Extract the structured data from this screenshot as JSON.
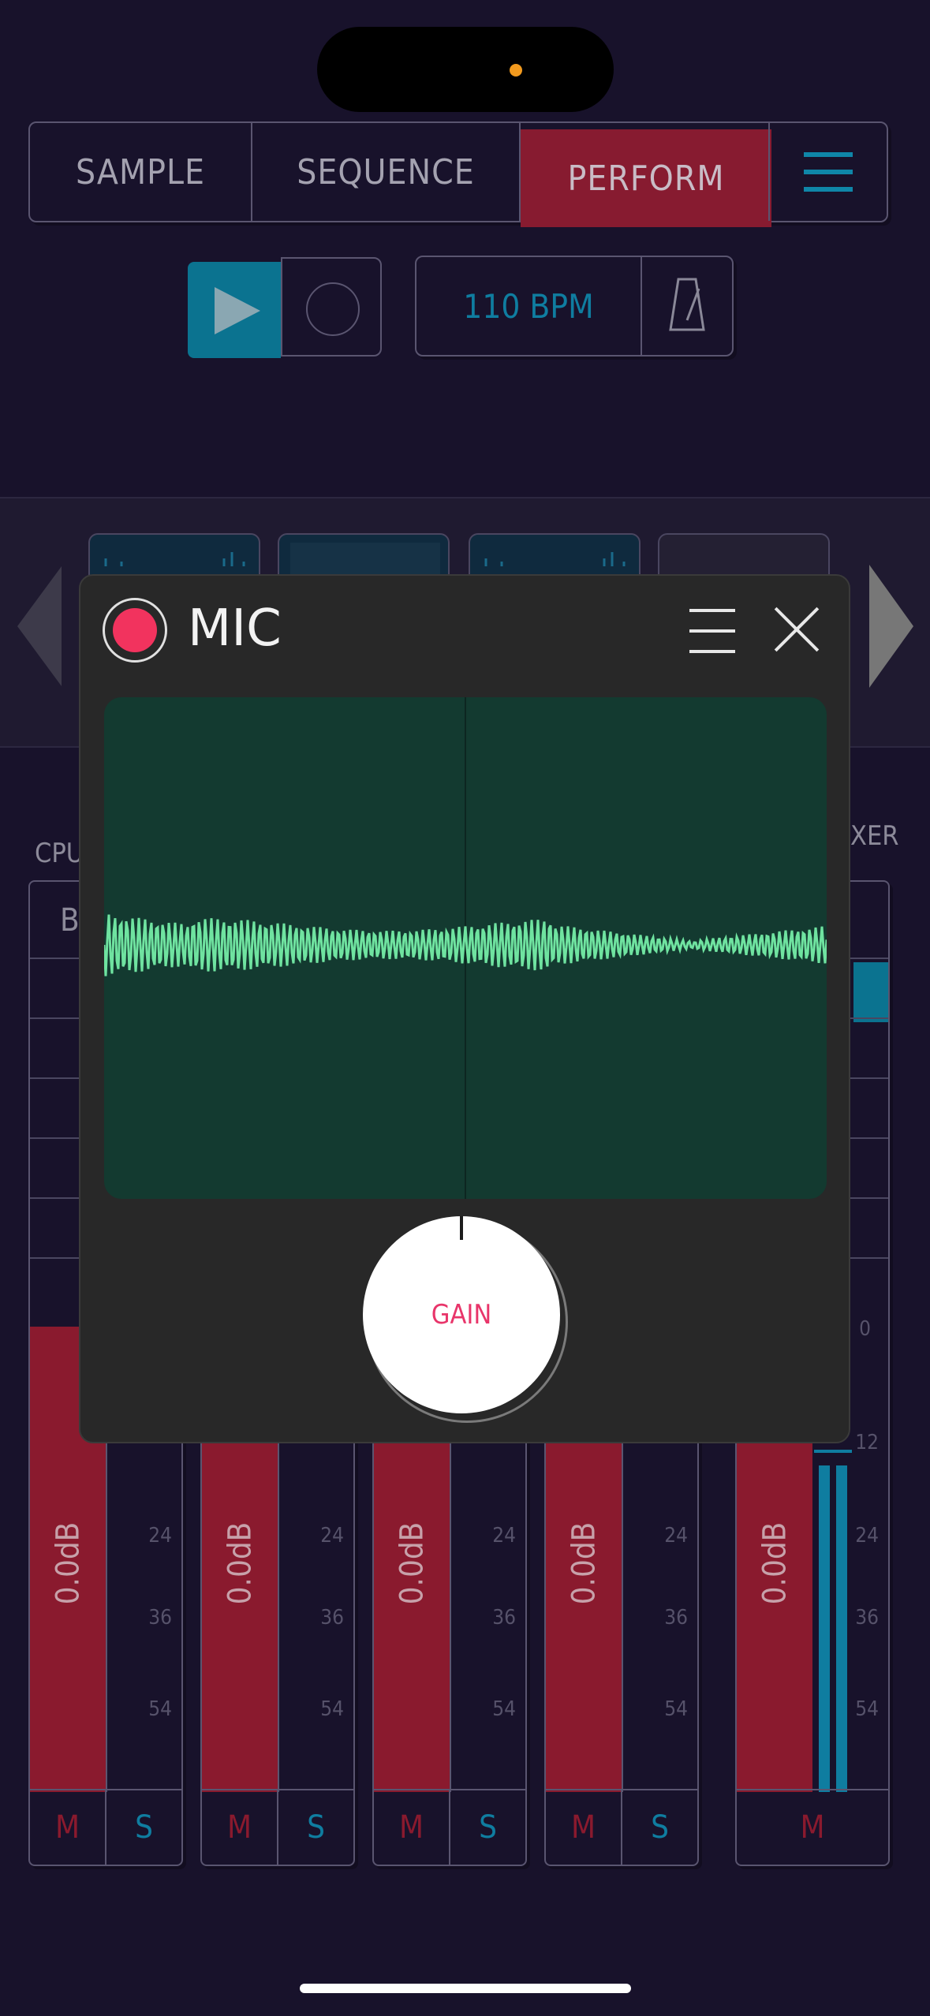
{
  "tabs": [
    {
      "label": "SAMPLE"
    },
    {
      "label": "SEQUENCE"
    },
    {
      "label": "PERFORM",
      "active": true
    }
  ],
  "transport": {
    "bpm": "110 BPM"
  },
  "background_labels": {
    "cpu": "CPU",
    "mixer": "XER",
    "track_first_label": "B"
  },
  "mixer": {
    "channels": [
      {
        "db": "0.0dB",
        "mute": "M",
        "solo": "S"
      },
      {
        "db": "0.0dB",
        "mute": "M",
        "solo": "S"
      },
      {
        "db": "0.0dB",
        "mute": "M",
        "solo": "S"
      },
      {
        "db": "0.0dB",
        "mute": "M",
        "solo": "S"
      },
      {
        "db": "0.0dB",
        "mute": "M"
      }
    ],
    "scale": [
      "0",
      "12",
      "24",
      "36",
      "54"
    ]
  },
  "modal": {
    "title": "MIC",
    "knob_label": "GAIN"
  },
  "colors": {
    "accent_red": "#871b30",
    "accent_blue": "#0f7da0",
    "wave_green": "#6fe3a0",
    "record_red": "#f2335e"
  }
}
